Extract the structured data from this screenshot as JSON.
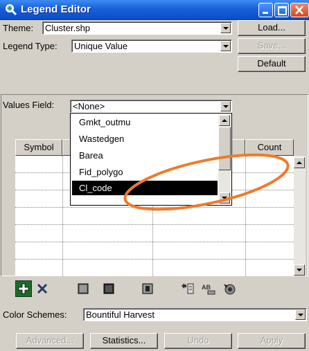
{
  "window": {
    "title": "Legend Editor",
    "buttons": [
      "minimize-button",
      "maximize-button",
      "close-button"
    ]
  },
  "theme": {
    "label": "Theme:",
    "value": "Cluster.shp"
  },
  "legend_type": {
    "label": "Legend Type:",
    "value": "Unique Value"
  },
  "side_buttons": {
    "load": "Load...",
    "save": "Save...",
    "default": "Default"
  },
  "values_field": {
    "label": "Values Field:",
    "value": "<None>",
    "options": [
      "Gmkt_outmu",
      "Wastedgen",
      "Barea",
      "Fid_polygo",
      "Cl_code"
    ],
    "highlighted": "Cl_code"
  },
  "grid": {
    "columns": [
      "Symbol",
      "Count"
    ],
    "rows": 7
  },
  "toolbar": {
    "icons": [
      "add-icon",
      "delete-icon",
      "shade-light-icon",
      "shade-dark-icon",
      "null-value-icon",
      "sort-icon",
      "label-icon",
      "advanced-icon"
    ]
  },
  "color_schemes": {
    "label": "Color Schemes:",
    "value": "Bountiful Harvest"
  },
  "bottom_buttons": {
    "advanced": "Advanced...",
    "statistics": "Statistics...",
    "undo": "Undo",
    "apply": "Apply"
  },
  "colors": {
    "title_bar": "#1a5fd6",
    "window_face": "#d4d0c8",
    "annotation": "#f07a2a"
  }
}
